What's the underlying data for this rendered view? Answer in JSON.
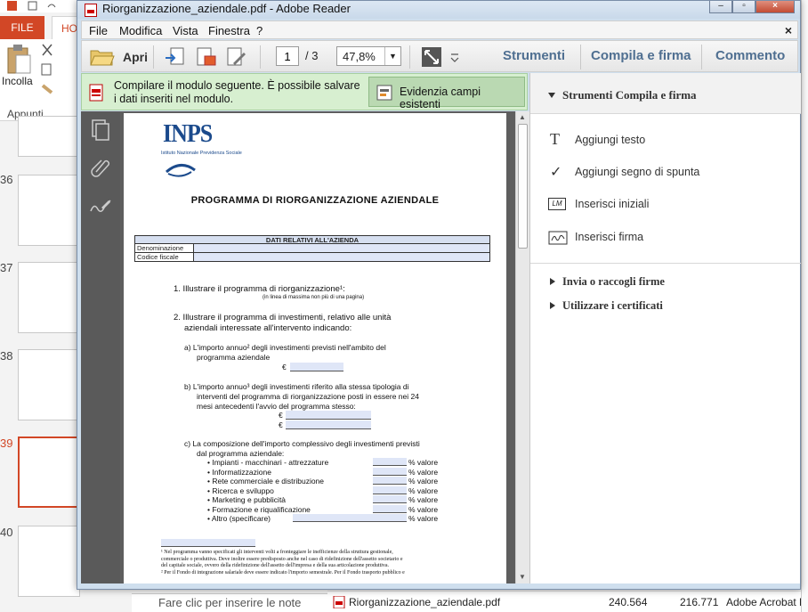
{
  "background_app": {
    "file_tab": "FILE",
    "home_tab": "HO",
    "paste_label": "Incolla",
    "clipboard_group": "Appunti",
    "slide_numbers": [
      "36",
      "37",
      "38",
      "39",
      "40"
    ],
    "notes_placeholder": "Fare clic per inserire le note",
    "explorer": {
      "file_name": "Riorganizzazione_aziendale.pdf",
      "size1": "240.564",
      "size2": "216.771",
      "app": "Adobe Acrobat D"
    }
  },
  "window": {
    "title": "Riorganizzazione_aziendale.pdf - Adobe Reader",
    "close_glyph": "×"
  },
  "menu": {
    "items": [
      "File",
      "Modifica",
      "Vista",
      "Finestra",
      "?"
    ],
    "close_glyph": "×"
  },
  "toolbar": {
    "open_label": "Apri",
    "page_current": "1",
    "page_total": "/ 3",
    "zoom": "47,8%",
    "tabs": [
      "Strumenti",
      "Compila e firma",
      "Commento"
    ]
  },
  "notification": {
    "text": "Compilare il modulo seguente. È possibile salvare i dati inseriti nel modulo.",
    "button": "Evidenzia campi esistenti"
  },
  "document": {
    "logo_text": "INPS",
    "logo_sub": "Istituto Nazionale Previdenza Sociale",
    "title": "PROGRAMMA DI RIORGANIZZAZIONE AZIENDALE",
    "table_header": "DATI RELATIVI ALL'AZIENDA",
    "table_rows": [
      "Denominazione",
      "Codice fiscale"
    ],
    "q1": "1. Illustrare il programma di riorganizzazione¹:",
    "q1_note": "(in linea di massima non più di una pagina)",
    "q2_line1": "2. Illustrare il programma di investimenti, relativo alle unità",
    "q2_line2": "aziendali interessate all'intervento indicando:",
    "a_line1": "a) L'importo annuo² degli investimenti previsti nell'ambito del",
    "a_line2": "programma aziendale",
    "b_line1": "b) L'importo annuo³ degli investimenti riferito alla stessa tipologia di",
    "b_line2": "interventi del programma di riorganizzazione posti in essere nei 24",
    "b_line3": "mesi antecedenti l'avvio del programma stesso:",
    "c_line1": "c) La composizione dell'importo complessivo degli investimenti previsti",
    "c_line2": "dal programma aziendale:",
    "euro": "€",
    "percent_label": "% valore",
    "items": [
      "Impianti - macchinari - attrezzature",
      "Informatizzazione",
      "Rete commerciale e distribuzione",
      "Ricerca e sviluppo",
      "Marketing e pubblicità",
      "Formazione e riqualificazione",
      "Altro (specificare)"
    ],
    "footnote1_a": "¹ Nel programma vanno specificati gli interventi volti a fronteggiare le inefficienze della struttura gestionale,",
    "footnote1_b": "commerciale o produttiva. Deve inoltre essere predisposto anche nel caso di ridefinizione dell'assetto societario e",
    "footnote1_c": "del capitale sociale, ovvero della ridefinizione dell'assetto dell'impresa e della sua articolazione produttiva.",
    "footnote2": "² Per il Fondo di integrazione salariale deve essere indicato l'importo semestrale. Per il Fondo trasporto pubblico e"
  },
  "tools_panel": {
    "header": "Strumenti Compila e firma",
    "tools": [
      "Aggiungi testo",
      "Aggiungi segno di spunta",
      "Inserisci iniziali",
      "Inserisci firma"
    ],
    "icon_text_glyph": "T",
    "icon_check_glyph": "✓",
    "icon_initials_glyph": "LM",
    "sections": [
      "Invia o raccogli firme",
      "Utilizzare i certificati"
    ]
  },
  "colors": {
    "accent": "#4f6f91",
    "notify_bg": "#d7efd0",
    "ppt_accent": "#d24726"
  }
}
